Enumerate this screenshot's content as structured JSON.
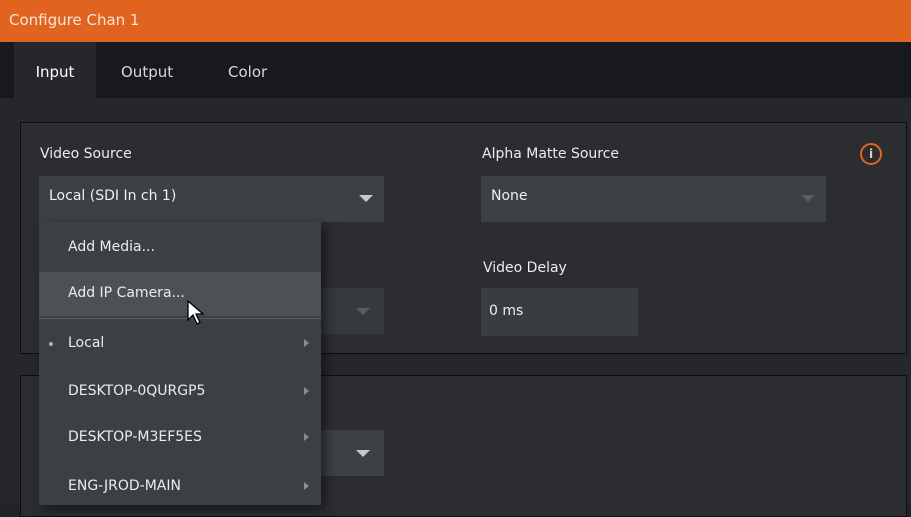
{
  "window": {
    "title": "Configure Chan 1"
  },
  "tabs": [
    {
      "label": "Input",
      "active": true
    },
    {
      "label": "Output",
      "active": false
    },
    {
      "label": "Color",
      "active": false
    }
  ],
  "video_source": {
    "label": "Video Source",
    "value": "Local (SDI In ch 1)"
  },
  "alpha_matte": {
    "label": "Alpha Matte Source",
    "value": "None"
  },
  "video_delay": {
    "label": "Video Delay",
    "value": "0 ms"
  },
  "info_icon": {
    "glyph": "i",
    "icon": "info-icon",
    "color": "#e0631f"
  },
  "menu": {
    "items": [
      {
        "label": "Add Media..."
      },
      {
        "label": "Add IP Camera..."
      },
      {
        "label": "Local"
      },
      {
        "label": "DESKTOP-0QURGP5"
      },
      {
        "label": "DESKTOP-M3EF5ES"
      },
      {
        "label": "ENG-JROD-MAIN"
      }
    ]
  },
  "colors": {
    "accent": "#e0631f",
    "background": "#25272b",
    "field": "#3d4044"
  }
}
